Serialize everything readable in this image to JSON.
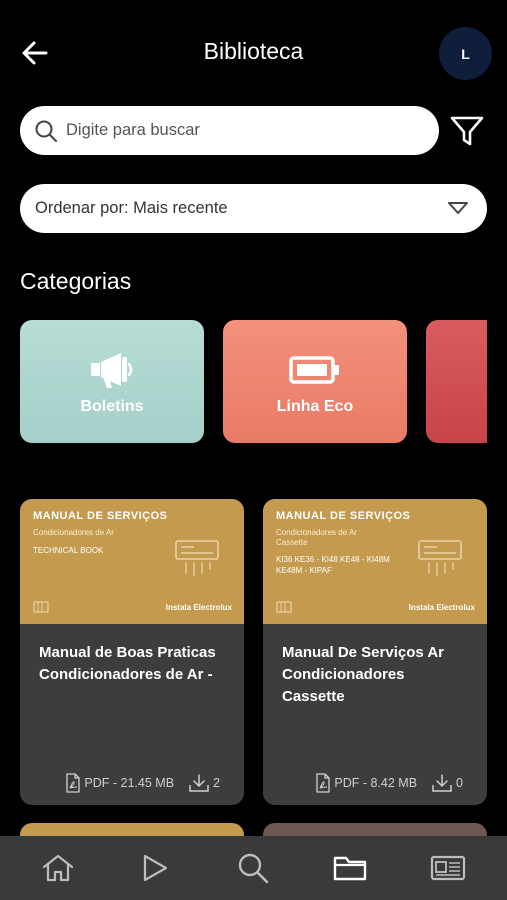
{
  "header": {
    "title": "Biblioteca",
    "avatar_initial": "L"
  },
  "search": {
    "placeholder": "Digite para buscar",
    "value": ""
  },
  "sort": {
    "label": "Ordenar por: Mais recente"
  },
  "categories": {
    "title": "Categorias",
    "items": [
      {
        "label": "Boletins",
        "icon": "megaphone-icon",
        "color": "#b0d8d1"
      },
      {
        "label": "Linha Eco",
        "icon": "battery-icon",
        "color": "#ee8671"
      },
      {
        "label": "",
        "icon": "",
        "color": "#d04f53"
      }
    ]
  },
  "documents": [
    {
      "cover_title": "MANUAL DE SERVIÇOS",
      "cover_subtitle": "Condicionadores de Ar",
      "cover_extra": "TECHNICAL BOOK",
      "cover_brand": "Instala Electrolux",
      "title": "Manual de Boas Praticas Condicionadores de Ar -",
      "file": "PDF - 21.45 MB",
      "downloads": "2"
    },
    {
      "cover_title": "MANUAL DE SERVIÇOS",
      "cover_subtitle": "Condicionadores de Ar Cassette",
      "cover_extra": "KI36 KE36 - KI48 KE48 - KI48M KE48M - KIPAF",
      "cover_brand": "Instala Electrolux",
      "title": "Manual De Serviços Ar Condicionadores Cassette",
      "file": "PDF - 8.42 MB",
      "downloads": "0"
    }
  ],
  "colors": {
    "background": "#000000",
    "cover_gold": "#c49a4e",
    "card_body": "#3d3d3d",
    "avatar": "#0f1e3b",
    "nav_bar": "#3a3a3a"
  },
  "bottom_nav": [
    {
      "icon": "home-icon"
    },
    {
      "icon": "play-icon"
    },
    {
      "icon": "search-icon"
    },
    {
      "icon": "folder-icon",
      "active": true
    },
    {
      "icon": "news-icon"
    }
  ]
}
